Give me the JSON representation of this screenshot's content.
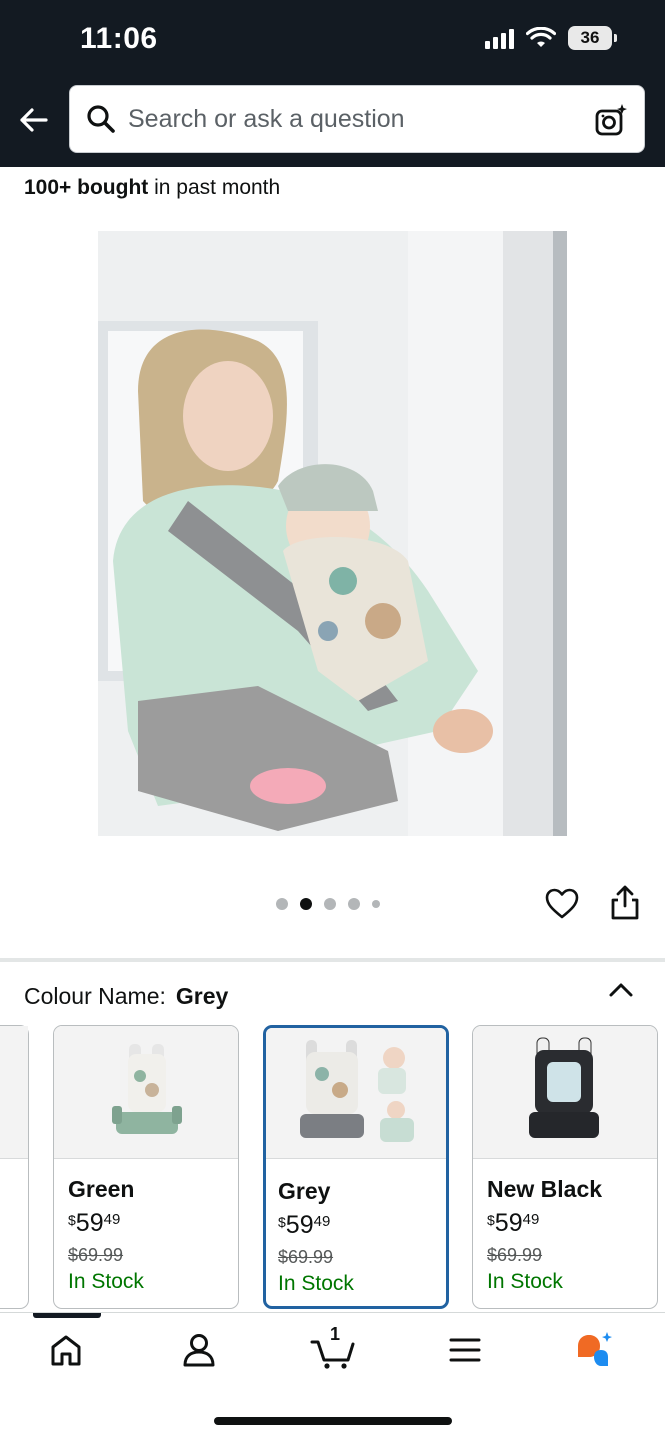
{
  "status_bar": {
    "time": "11:06",
    "battery": "36"
  },
  "search": {
    "placeholder": "Search or ask a question"
  },
  "social_proof": {
    "bold": "100+ bought",
    "rest": " in past month"
  },
  "carousel": {
    "dot_count": 5,
    "active_index": 1
  },
  "variation": {
    "label": "Colour Name:",
    "selected": "Grey"
  },
  "swatches": [
    {
      "name": "Green",
      "currency": "$",
      "whole": "59",
      "fraction": "49",
      "list_price": "$69.99",
      "availability": "In Stock",
      "selected": false,
      "color": "#8fb4a0"
    },
    {
      "name": "Grey",
      "currency": "$",
      "whole": "59",
      "fraction": "49",
      "list_price": "$69.99",
      "availability": "In Stock",
      "selected": true,
      "color": "#7b7e83"
    },
    {
      "name": "New Black",
      "currency": "$",
      "whole": "59",
      "fraction": "49",
      "list_price": "$69.99",
      "availability": "In Stock",
      "selected": false,
      "color": "#25272b"
    }
  ],
  "cart": {
    "count": "1"
  },
  "colors": {
    "header_bg": "#131a22",
    "in_stock": "#007600",
    "selected_border": "#2162a1",
    "rufus_orange": "#f06a24",
    "rufus_blue": "#1d8cf0"
  },
  "icons": [
    "back-arrow-icon",
    "search-icon",
    "camera-lens-icon",
    "heart-icon",
    "share-icon",
    "chevron-up-icon",
    "home-icon",
    "account-icon",
    "cart-icon",
    "menu-icon",
    "rufus-icon"
  ]
}
